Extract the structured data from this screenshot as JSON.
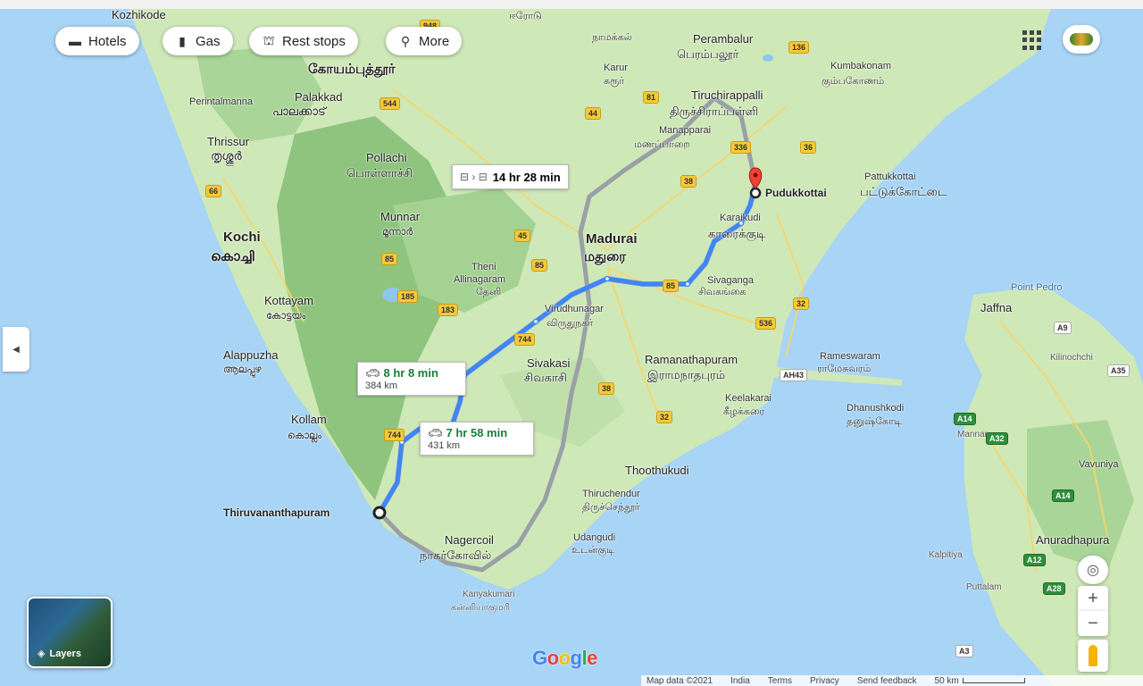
{
  "toolbar": {
    "hotels": "Hotels",
    "gas": "Gas",
    "rest_stops": "Rest stops",
    "more": "More"
  },
  "routes": {
    "transit": {
      "time": "14 hr 28 min"
    },
    "route1": {
      "time": "8 hr 8 min",
      "distance": "384 km"
    },
    "route2": {
      "time": "7 hr 58 min",
      "distance": "431 km"
    }
  },
  "endpoints": {
    "origin": "Thiruvananthapuram",
    "destination": "Pudukkottai"
  },
  "places": {
    "kozhikode": "Kozhikode",
    "coimbatore_ta": "கோயம்புத்தூர்",
    "palakkad": "Palakkad",
    "palakkad_ml": "പാലക്കാട്",
    "perintalmanna": "Perintalmanna",
    "thrissur": "Thrissur",
    "thrissur_ml": "തൃശ്ശൂർ",
    "pollachi": "Pollachi",
    "pollachi_ta": "பொள்ளாச்சி",
    "kochi": "Kochi",
    "kochi_ml": "കൊച്ചി",
    "munnar": "Munnar",
    "munnar_ml": "മൂന്നാർ",
    "kottayam": "Kottayam",
    "kottayam_ml": "കോട്ടയം",
    "alappuzha": "Alappuzha",
    "alappuzha_ml": "ആലപ്പുഴ",
    "kollam": "Kollam",
    "kollam_ml": "കൊല്ലം",
    "theni": "Theni",
    "allinagaram": "Allinagaram",
    "theni_ta": "தேனி",
    "madurai": "Madurai",
    "madurai_ta": "மதுரை",
    "virudhunagar": "Virudhunagar",
    "virudhunagar_ta": "விருதுநகர்",
    "sivakasi": "Sivakasi",
    "sivakasi_ta": "சிவகாசி",
    "sivaganga": "Sivaganga",
    "sivaganga_ta": "சிவகங்கை",
    "karaikudi": "Karaikudi",
    "karaikudi_ta": "காரைக்குடி",
    "ramanathapuram": "Ramanathapuram",
    "ramanathapuram_ta": "இராமநாதபுரம்",
    "keelakarai": "Keelakarai",
    "keelakarai_ta": "கீழக்கரை",
    "rameswaram": "Rameswaram",
    "rameswaram_ta": "ராமேசுவரம்",
    "dhanushkodi": "Dhanushkodi",
    "dhanushkodi_ta": "தனுஷ்கோடி",
    "thoothukudi": "Thoothukudi",
    "thiruchendur": "Thiruchendur",
    "thiruchendur_ta": "திருச்செந்தூர்",
    "udangudi": "Udangudi",
    "udangudi_ta": "உடன்குடி",
    "nagercoil": "Nagercoil",
    "nagercoil_ta": "நாகர்கோவில்",
    "kanyakumari": "Kanyakumari",
    "kanyakumari_ta": "கன்னியாகுமரி",
    "erode_ta": "ஈரோடு",
    "namakkal_ta": "நாமக்கல்",
    "karur": "Karur",
    "karur_ta": "கரூர்",
    "perambalur": "Perambalur",
    "perambalur_ta": "பெரம்பலூர்",
    "tiruchirappalli": "Tiruchirappalli",
    "tiruchirappalli_ta": "திருச்சிராப்பள்ளி",
    "manapparai": "Manapparai",
    "manapparai_ta": "மணப்பாறை",
    "kumbakonam": "Kumbakonam",
    "kumbakonam_ta": "கும்பகோணம்",
    "pattukkottai": "Pattukkottai",
    "pattukkottai_ta": "பட்டுக்கோட்டை",
    "point_pedro": "Point Pedro",
    "jaffna": "Jaffna",
    "kilinochchi": "Kilinochchi",
    "mannar": "Mannar",
    "vavuniya": "Vavuniya",
    "anuradhapura": "Anuradhapura",
    "kalpitiya": "Kalpitiya",
    "puttalam": "Puttalam"
  },
  "shields": [
    "948",
    "544",
    "81",
    "44",
    "136",
    "336",
    "36",
    "66",
    "38",
    "45",
    "85",
    "85",
    "185",
    "183",
    "744",
    "38",
    "32",
    "536",
    "32",
    "A9",
    "A35",
    "A14",
    "A32",
    "A14",
    "A12",
    "A28",
    "A3",
    "AH43",
    "744",
    "85"
  ],
  "map_controls": {
    "layers": "Layers"
  },
  "footer": {
    "map_data": "Map data ©2021",
    "india": "India",
    "terms": "Terms",
    "privacy": "Privacy",
    "send_feedback": "Send feedback",
    "scale": "50 km"
  },
  "colors": {
    "route_active": "#4285f4",
    "route_alt": "#9aa0a6",
    "land": "#c8e6b4",
    "forest": "#9ccc8c",
    "sea": "#a8d4f5",
    "pin": "#ea4335"
  }
}
